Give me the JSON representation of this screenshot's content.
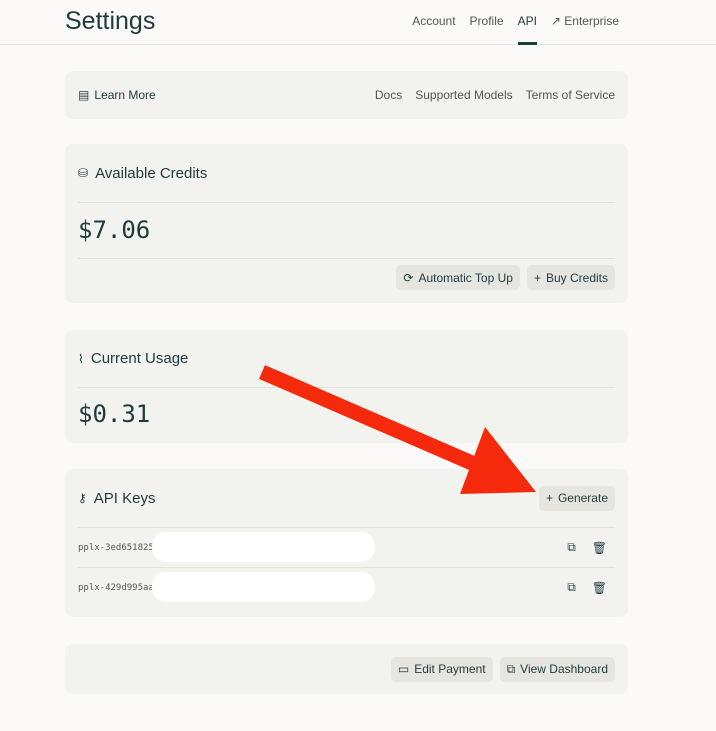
{
  "header": {
    "title": "Settings",
    "tabs": [
      {
        "label": "Account"
      },
      {
        "label": "Profile"
      },
      {
        "label": "API",
        "active": true
      },
      {
        "label": "↗ Enterprise"
      }
    ]
  },
  "learn": {
    "label": "Learn More",
    "links": [
      "Docs",
      "Supported Models",
      "Terms of Service"
    ]
  },
  "credits": {
    "title": "Available Credits",
    "amount": "$7.06",
    "auto_topup": "Automatic Top Up",
    "buy": "Buy Credits"
  },
  "usage": {
    "title": "Current Usage",
    "amount": "$0.31"
  },
  "keys": {
    "title": "API Keys",
    "generate": "Generate",
    "items": [
      {
        "key": "pplx-3ed651825"
      },
      {
        "key": "pplx-429d995aa"
      }
    ]
  },
  "footer": {
    "edit_payment": "Edit Payment",
    "view_dashboard": "View Dashboard"
  },
  "colors": {
    "arrow": "#f52a0c"
  }
}
